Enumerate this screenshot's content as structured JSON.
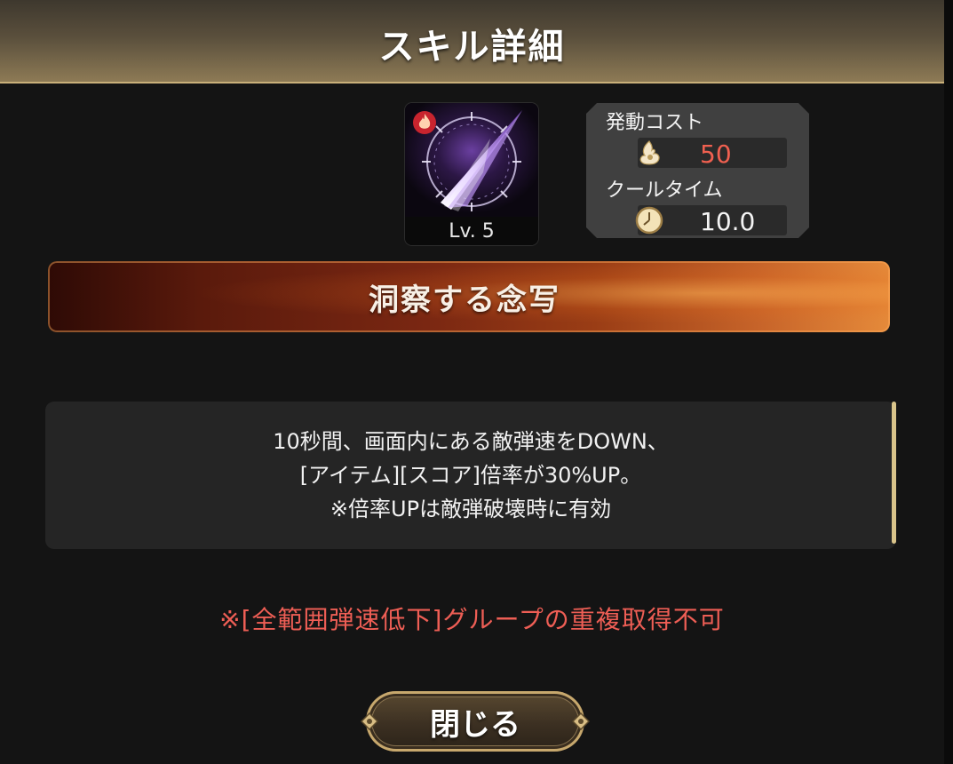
{
  "header": {
    "title": "スキル詳細"
  },
  "skill": {
    "level_label": "Lv. 5",
    "element_icon": "fire-icon",
    "name": "洞察する念写"
  },
  "stats": {
    "cost_label": "発動コスト",
    "cost_value": "50",
    "cost_icon": "spirit-flame-icon",
    "cooldown_label": "クールタイム",
    "cooldown_value": "10.0",
    "cooldown_icon": "clock-icon"
  },
  "description": {
    "lines": [
      "10秒間、画面内にある敵弾速をDOWN、",
      "[アイテム][スコア]倍率が30%UP。",
      "※倍率UPは敵弾破壊時に有効"
    ]
  },
  "warning": "※[全範囲弾速低下]グループの重複取得不可",
  "close_button": {
    "label": "閉じる"
  },
  "colors": {
    "accent_gold": "#c9b07a",
    "cost_red": "#f06050",
    "warning_red": "#ee5e55",
    "banner_orange": "#c8652a"
  }
}
